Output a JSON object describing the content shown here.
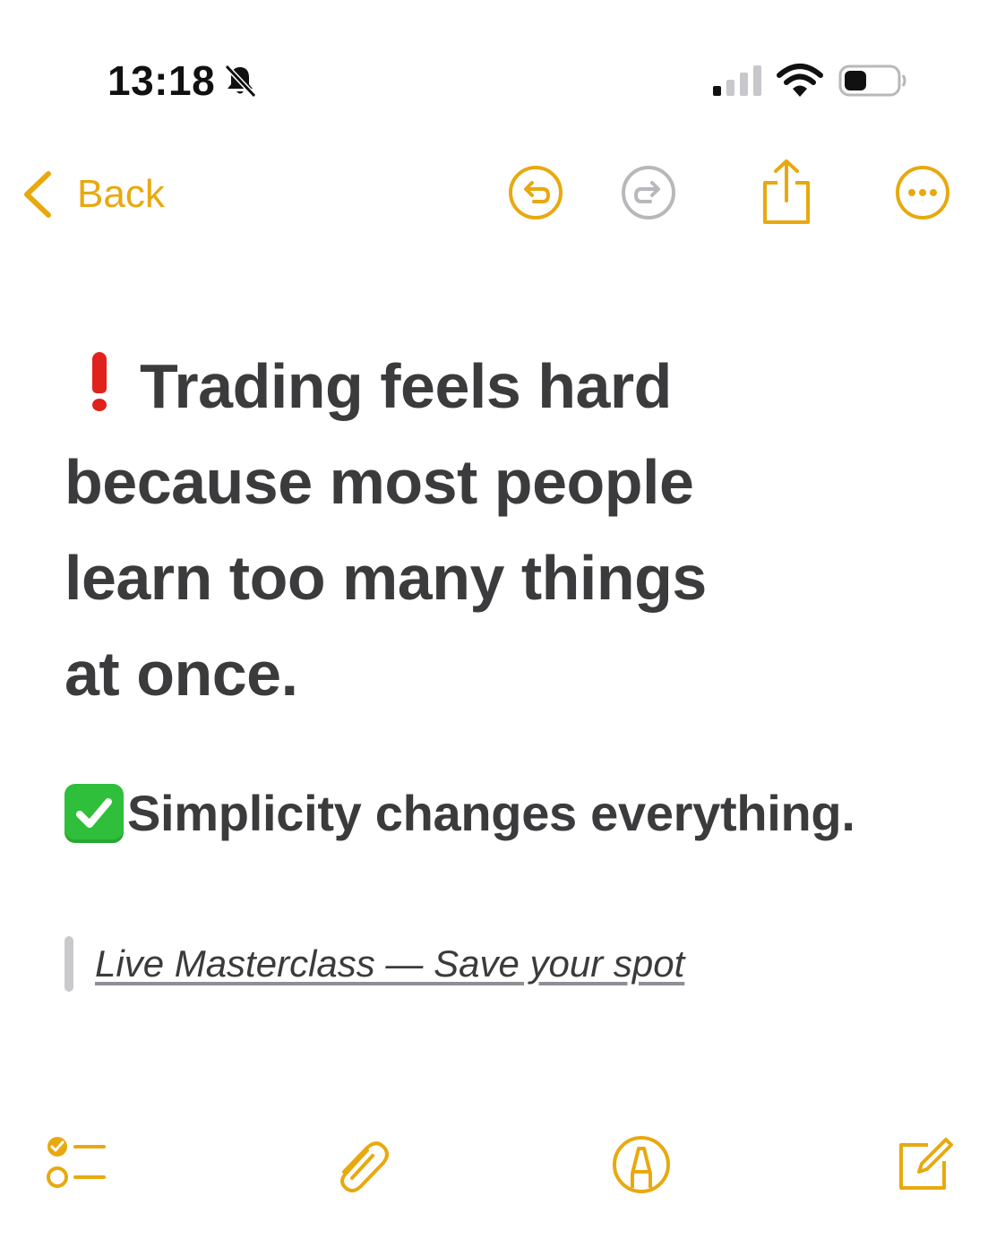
{
  "status_bar": {
    "time": "13:18",
    "icons": [
      "bell-slash-icon",
      "cellular-signal-icon",
      "wifi-icon",
      "battery-icon"
    ]
  },
  "nav": {
    "back_label": "Back",
    "icons": [
      "undo-icon",
      "redo-icon",
      "share-icon",
      "more-icon"
    ]
  },
  "note": {
    "headline_lines": [
      "Trading feels hard",
      "because most people",
      "learn too many things",
      "at once."
    ],
    "subline": "Simplicity changes everything.",
    "quote_link": "Live Masterclass — Save your spot"
  },
  "toolbar": {
    "icons": [
      "checklist-icon",
      "paperclip-icon",
      "markup-pen-icon",
      "compose-icon"
    ]
  },
  "colors": {
    "accent": "#e8a90f",
    "text": "#3b3b3d",
    "exclamation": "#e0221b",
    "check_green": "#2fbf3a",
    "disabled": "#b8b8bc"
  }
}
